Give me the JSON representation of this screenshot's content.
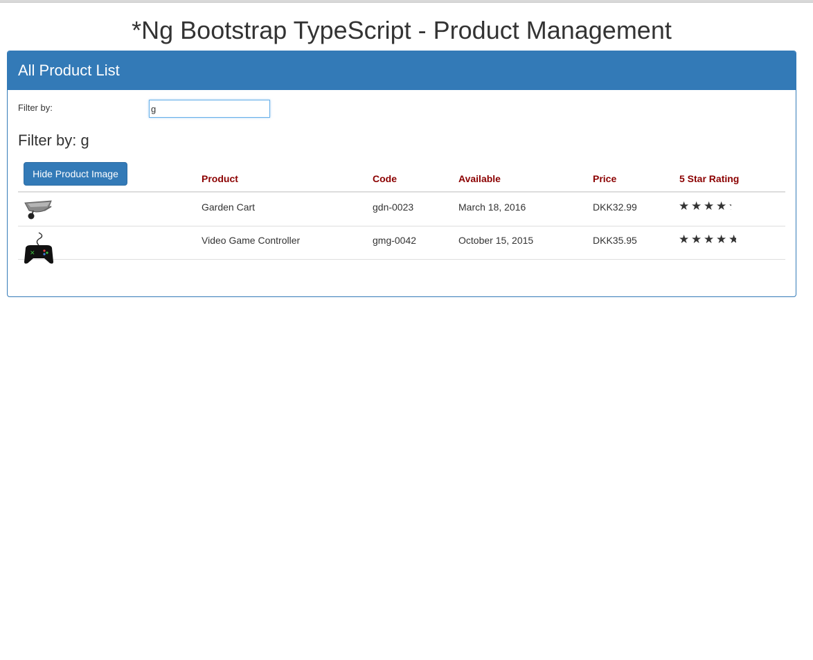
{
  "page": {
    "title": "*Ng Bootstrap TypeScript - Product Management"
  },
  "panel": {
    "heading": "All Product List",
    "filter_label": "Filter by:",
    "filter_value": "g",
    "filter_heading": "Filter by: g",
    "toggle_button_label": "Hide Product Image"
  },
  "table": {
    "columns": [
      "Product",
      "Code",
      "Available",
      "Price",
      "5 Star Rating"
    ],
    "rows": [
      {
        "image_icon": "garden-cart-icon",
        "product": "Garden Cart",
        "code": "gdn-0023",
        "available": "March 18, 2016",
        "price": "DKK32.99",
        "rating": 4.2
      },
      {
        "image_icon": "game-controller-icon",
        "product": "Video Game Controller",
        "code": "gmg-0042",
        "available": "October 15, 2015",
        "price": "DKK35.95",
        "rating": 4.6
      }
    ]
  },
  "colors": {
    "primary": "#337ab7",
    "header_text": "#8b0000",
    "text": "#333333"
  }
}
